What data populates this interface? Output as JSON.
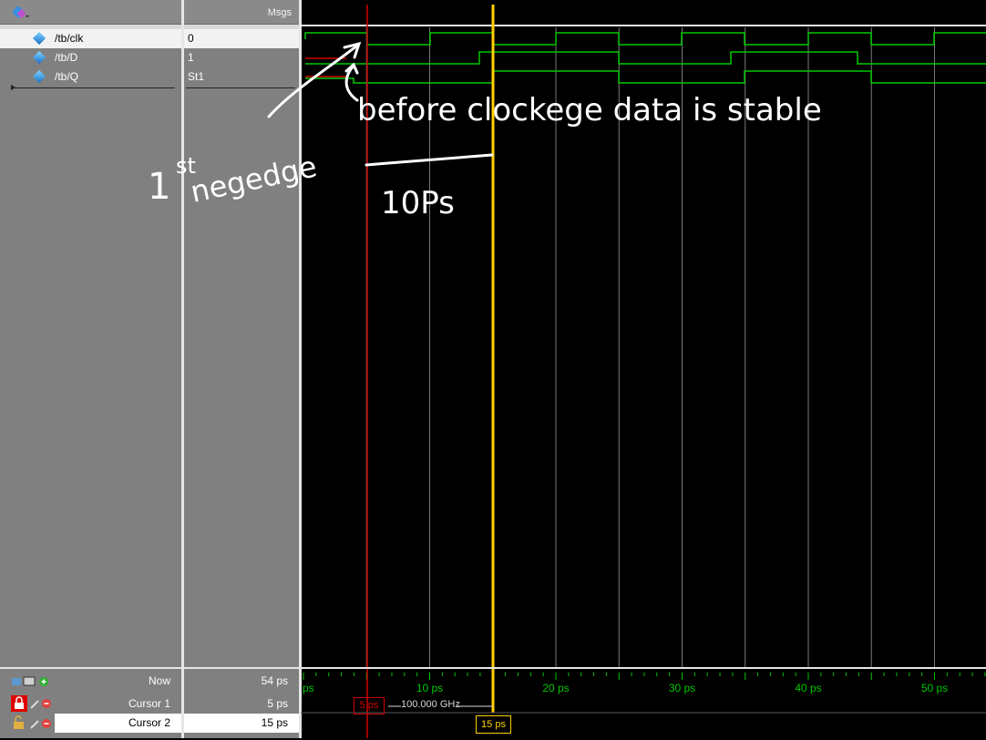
{
  "header": {
    "msgs_label": "Msgs"
  },
  "signals": [
    {
      "name": "/tb/clk",
      "value": "0"
    },
    {
      "name": "/tb/D",
      "value": "1"
    },
    {
      "name": "/tb/Q",
      "value": "St1"
    }
  ],
  "timeline": {
    "ticks": [
      {
        "label": "ps",
        "t": 0
      },
      {
        "label": "10 ps",
        "t": 10
      },
      {
        "label": "20 ps",
        "t": 20
      },
      {
        "label": "30 ps",
        "t": 30
      },
      {
        "label": "40 ps",
        "t": 40
      },
      {
        "label": "50 ps",
        "t": 50
      }
    ]
  },
  "bottom": {
    "now_label": "Now",
    "now_value": "54 ps",
    "cursor1_label": "Cursor 1",
    "cursor1_value": "5 ps",
    "cursor2_label": "Cursor 2",
    "cursor2_value": "15 ps",
    "cursor1_tag": "5 ps",
    "cursor2_tag": "15 ps",
    "freq": "100.000 GHz"
  },
  "annotations": {
    "a1": "1",
    "a1sup": "st",
    "a1b": "negedge",
    "a2": "before clockege data is stable",
    "a3": "10Ps"
  },
  "colors": {
    "wave": "#00c800",
    "cursor1": "#d00000",
    "cursor2": "#ffd000",
    "grid": "#7a7a7a"
  }
}
